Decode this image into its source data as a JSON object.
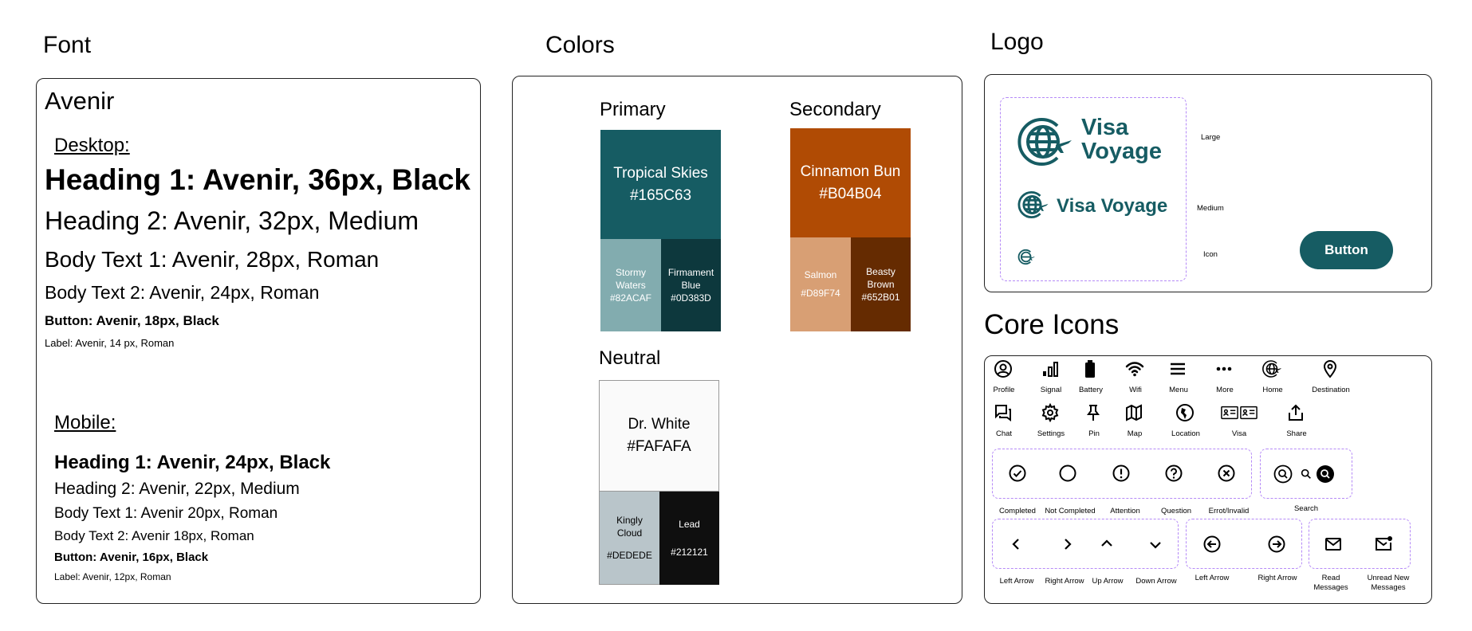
{
  "colors_theme": {
    "primary": "#165C63",
    "secondary": "#B04B04",
    "text": "#000000",
    "dash": "#B58AF7"
  },
  "font": {
    "title": "Font",
    "family": "Avenir",
    "desktop_label": "Desktop:",
    "desktop": [
      "Heading 1: Avenir, 36px, Black",
      "Heading 2: Avenir, 32px, Medium",
      "Body Text 1: Avenir,  28px, Roman",
      "Body Text 2: Avenir,  24px, Roman",
      "Button: Avenir, 18px, Black",
      "Label: Avenir, 14 px, Roman"
    ],
    "mobile_label": "Mobile:",
    "mobile": [
      "Heading 1: Avenir, 24px, Black",
      "Heading 2: Avenir, 22px, Medium",
      "Body Text 1: Avenir  20px, Roman",
      "Body Text 2: Avenir  18px, Roman",
      "Button: Avenir, 16px, Black",
      "Label: Avenir, 12px, Roman"
    ]
  },
  "colors": {
    "title": "Colors",
    "primary": {
      "heading": "Primary",
      "main": {
        "name": "Tropical Skies",
        "hex": "#165C63"
      },
      "light": {
        "name": "Stormy Waters",
        "hex": "#82ACAF"
      },
      "dark": {
        "name": "Firmament Blue",
        "hex": "#0D383D"
      }
    },
    "secondary": {
      "heading": "Secondary",
      "main": {
        "name": "Cinnamon Bun",
        "hex": "#B04B04"
      },
      "light": {
        "name": "Salmon",
        "hex": "#D89F74"
      },
      "dark": {
        "name": "Beasty Brown",
        "hex": "#652B01"
      }
    },
    "neutral": {
      "heading": "Neutral",
      "main": {
        "name": "Dr. White",
        "hex": "#FAFAFA"
      },
      "light": {
        "name": "Kingly Cloud",
        "hex": "#DEDEDE"
      },
      "dark": {
        "name": "Lead",
        "hex": "#212121"
      }
    }
  },
  "logo": {
    "title": "Logo",
    "wordmark_line1": "Visa",
    "wordmark_line2": "Voyage",
    "wordmark_inline": "Visa Voyage",
    "size_labels": {
      "large": "Large",
      "medium": "Medium",
      "icon": "Icon"
    },
    "button_label": "Button"
  },
  "core_icons": {
    "title": "Core Icons",
    "row1": [
      {
        "label": "Profile",
        "icon": "profile-icon"
      },
      {
        "label": "Signal",
        "icon": "signal-icon"
      },
      {
        "label": "Battery",
        "icon": "battery-icon"
      },
      {
        "label": "Wifi",
        "icon": "wifi-icon"
      },
      {
        "label": "Menu",
        "icon": "menu-icon"
      },
      {
        "label": "More",
        "icon": "more-icon"
      },
      {
        "label": "Home",
        "icon": "home-globe-icon"
      },
      {
        "label": "Destination",
        "icon": "destination-pin-icon"
      }
    ],
    "row2": [
      {
        "label": "Chat",
        "icon": "chat-icon"
      },
      {
        "label": "Settings",
        "icon": "settings-gear-icon"
      },
      {
        "label": "Pin",
        "icon": "pin-icon"
      },
      {
        "label": "Map",
        "icon": "map-icon"
      },
      {
        "label": "Location",
        "icon": "location-icon"
      },
      {
        "label": "Visa",
        "icon": "visa-card-icon"
      },
      {
        "label": "Share",
        "icon": "share-icon"
      }
    ],
    "status": [
      {
        "label": "Completed",
        "icon": "check-circle-icon"
      },
      {
        "label": "Not Completed",
        "icon": "empty-circle-icon"
      },
      {
        "label": "Attention",
        "icon": "exclamation-circle-icon"
      },
      {
        "label": "Question",
        "icon": "question-circle-icon"
      },
      {
        "label": "Errot/Invalid",
        "icon": "x-circle-icon"
      }
    ],
    "search_label": "Search",
    "arrows": [
      {
        "label": "Left Arrow",
        "icon": "chevron-left-icon"
      },
      {
        "label": "Right Arrow",
        "icon": "chevron-right-icon"
      },
      {
        "label": "Up  Arrow",
        "icon": "chevron-up-icon"
      },
      {
        "label": "Down Arrow",
        "icon": "chevron-down-icon"
      }
    ],
    "circle_arrows": [
      {
        "label": "Left Arrow",
        "icon": "circle-arrow-left-icon"
      },
      {
        "label": "Right Arrow",
        "icon": "circle-arrow-right-icon"
      }
    ],
    "messages": [
      {
        "label": "Read Messages",
        "icon": "mail-icon"
      },
      {
        "label": "Unread New Messages",
        "icon": "mail-unread-icon"
      }
    ]
  }
}
